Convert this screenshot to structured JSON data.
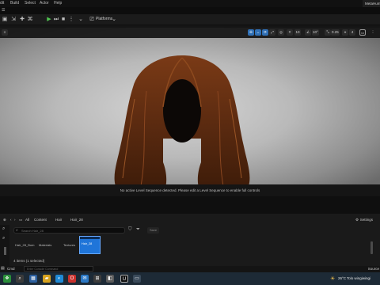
{
  "menu": {
    "items": [
      "dit",
      "Build",
      "Select",
      "Actor",
      "Help"
    ],
    "window_title": "MetaHuman"
  },
  "toolbar": {
    "platforms_label": "Platforms"
  },
  "viewport": {
    "toolbar": {
      "value_1": "0.25",
      "value_2": "10",
      "value_3": "4"
    },
    "message": "No active Level Sequence detected. Please edit a Level Sequence to enable full controls"
  },
  "content_browser": {
    "breadcrumbs": [
      "All",
      "Content",
      "Hair",
      "Hair_28"
    ],
    "settings_label": "Settings",
    "search_placeholder": "Search Hair_28",
    "save_label": "Save",
    "columns": [
      "Hair_28_Bum",
      "Materials",
      "Textures"
    ],
    "selected_asset": "Hair_28",
    "item_count": "4 items (1 selected)"
  },
  "status": {
    "console_label": "Cmd",
    "console_placeholder": "Enter Console Command",
    "source_label": "Source"
  },
  "taskbar": {
    "temperature": "26°C",
    "weather": "Tolo wingiwingi"
  },
  "colors": {
    "accent": "#2f6fb5",
    "selection": "#1f75d9",
    "hair": "#6b2f12"
  }
}
